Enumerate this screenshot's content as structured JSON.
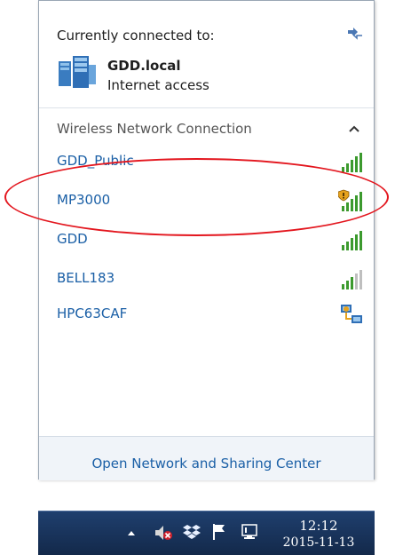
{
  "panel": {
    "connected_label": "Currently connected to:",
    "current_network": {
      "name": "GDD.local",
      "status": "Internet access",
      "icon": "network-icon"
    },
    "section_title": "Wireless Network Connection",
    "wifi_networks": [
      {
        "name": "GDD_Public",
        "signal": "full",
        "secured": false
      },
      {
        "name": "MP3000",
        "signal": "full",
        "secured": true
      },
      {
        "name": "GDD",
        "signal": "full",
        "secured": false
      },
      {
        "name": "BELL183",
        "signal": "medium",
        "secured": false
      },
      {
        "name": "HPC63CAF",
        "signal": "adhoc",
        "secured": false
      }
    ],
    "footer_link": "Open Network and Sharing Center"
  },
  "taskbar": {
    "time": "12:12",
    "date": "2015-11-13",
    "tray_icons": [
      "show-hidden-icons",
      "volume-muted-icon",
      "dropbox-icon",
      "action-center-flag-icon",
      "network-icon"
    ]
  },
  "colors": {
    "link": "#1a5fa6",
    "signal_green": "#3c9a2e",
    "annotation": "#e3161e",
    "taskbar": "#1c3a66"
  }
}
